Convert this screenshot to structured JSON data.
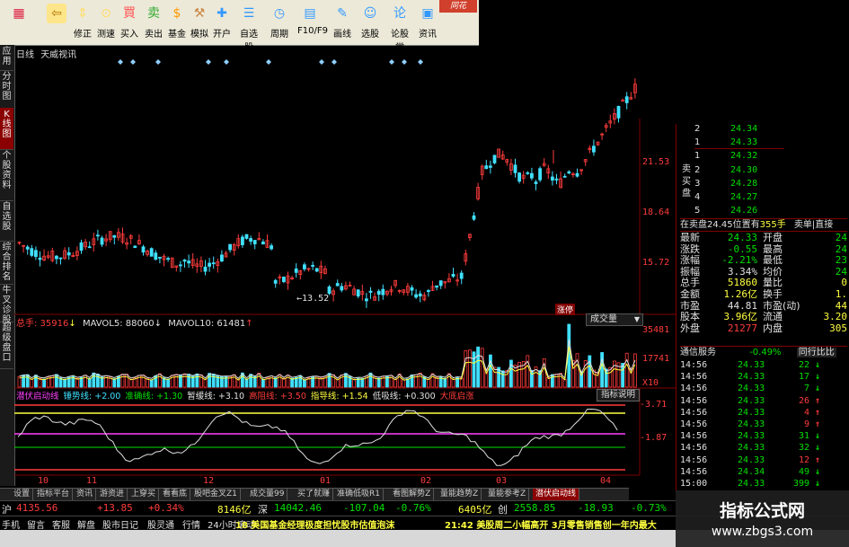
{
  "toolbar": {
    "buttons": [
      {
        "label": "",
        "icon": "grid-icon"
      },
      {
        "label": "",
        "icon": "back-arrow-icon"
      },
      {
        "label": "修正",
        "icon": "up-down-icon"
      },
      {
        "label": "测速",
        "icon": "speed-icon"
      },
      {
        "label": "买入",
        "icon": "buy-icon"
      },
      {
        "label": "卖出",
        "icon": "sell-icon"
      },
      {
        "label": "基金",
        "icon": "fund-icon"
      },
      {
        "label": "模拟",
        "icon": "gavel-icon"
      },
      {
        "label": "开户",
        "icon": "account-icon"
      },
      {
        "label": "自选股",
        "icon": "self-select-icon"
      },
      {
        "label": "周期",
        "icon": "clock-icon"
      },
      {
        "label": "F10/F9",
        "icon": "f10-icon"
      },
      {
        "label": "画线",
        "icon": "pencil-icon"
      },
      {
        "label": "选股",
        "icon": "person-icon"
      },
      {
        "label": "论股堂",
        "icon": "forum-icon"
      },
      {
        "label": "资讯",
        "icon": "news-icon"
      }
    ],
    "brand": "同花"
  },
  "left_tabs": [
    {
      "label": "应用",
      "active": false
    },
    {
      "label": "分时图",
      "active": false
    },
    {
      "label": "K线图",
      "active": true
    },
    {
      "label": "个股资料",
      "active": false
    },
    {
      "label": "自选股",
      "active": false
    },
    {
      "label": "综合排名",
      "active": false
    },
    {
      "label": "牛叉诊股",
      "active": false
    },
    {
      "label": "超级盘口",
      "active": false
    }
  ],
  "chart": {
    "period_label": "日线",
    "source_label": "天威视讯",
    "price_axis": [
      "21.53",
      "18.64",
      "15.72"
    ],
    "low_marker": "13.52",
    "volume_header": {
      "total": "总手: 35916",
      "mavol5": "MAVOL5: 88060",
      "mavol10": "MAVOL10: 61481"
    },
    "volume_axis": [
      "35481",
      "17741",
      "X10"
    ],
    "volume_dropdown": "成交量",
    "tag_label": "涨停",
    "indicator_header": [
      {
        "text": "潜伏启动线",
        "color": "#ff40ff"
      },
      {
        "text": "锤势线: +2.00",
        "color": "#40e0ff"
      },
      {
        "text": "准确线: +1.30",
        "color": "#00e000"
      },
      {
        "text": "暂缓线: +3.10",
        "color": "#e0e0e0"
      },
      {
        "text": "高阻线: +3.50",
        "color": "#ff3c3c"
      },
      {
        "text": "指导线: +1.54",
        "color": "#ffff40"
      },
      {
        "text": "低吸线: +0.300",
        "color": "#e0e0e0"
      },
      {
        "text": "大底启涨",
        "color": "#ff3c3c"
      }
    ],
    "indicator_button": "指标说明",
    "indicator_axis": [
      "3.71",
      "1.87"
    ],
    "x_axis": [
      "10",
      "11",
      "12",
      "01",
      "02",
      "03",
      "04"
    ]
  },
  "right_panel": {
    "sell_label": "卖",
    "buy_label": "买盘",
    "order_book": [
      {
        "level": "2",
        "price": "24.34"
      },
      {
        "level": "1",
        "price": "24.33"
      },
      {
        "level": "1",
        "price": "24.32"
      },
      {
        "level": "2",
        "price": "24.30"
      },
      {
        "level": "3",
        "price": "24.28"
      },
      {
        "level": "4",
        "price": "24.27"
      },
      {
        "level": "5",
        "price": "24.26"
      }
    ],
    "row_in_sell": "在卖盘24.45位置有",
    "row_in_sell_qty": "355手",
    "row_in_sell_action": "卖单",
    "row_in_sell_extra": "直接",
    "stats": [
      {
        "k": "最新",
        "v": "24.33",
        "k2": "开盘",
        "v2": "24"
      },
      {
        "k": "涨跌",
        "v": "-0.55",
        "k2": "最高",
        "v2": "24"
      },
      {
        "k": "涨幅",
        "v": "-2.21%",
        "k2": "最低",
        "v2": "23"
      },
      {
        "k": "振幅",
        "v": "3.34%",
        "k2": "均价",
        "v2": "24"
      },
      {
        "k": "总手",
        "v": "51860",
        "k2": "量比",
        "v2": "0"
      },
      {
        "k": "金额",
        "v": "1.26亿",
        "k2": "换手",
        "v2": "1."
      },
      {
        "k": "市盈",
        "v": "44.81",
        "k2": "市盈(动)",
        "v2": "44"
      },
      {
        "k": "股本",
        "v": "3.96亿",
        "k2": "流通",
        "v2": "3.20"
      },
      {
        "k": "外盘",
        "v": "21277",
        "k2": "内盘",
        "v2": "305"
      }
    ],
    "tick_header": "通信服务",
    "tick_header_pct": "-0.49%",
    "tick_header_btn": "同行比比",
    "ticks": [
      {
        "t": "14:56",
        "p": "24.33",
        "v": "22",
        "dir": "down"
      },
      {
        "t": "14:56",
        "p": "24.33",
        "v": "17",
        "dir": "down"
      },
      {
        "t": "14:56",
        "p": "24.33",
        "v": "7",
        "dir": "down"
      },
      {
        "t": "14:56",
        "p": "24.33",
        "v": "26",
        "dir": "up"
      },
      {
        "t": "14:56",
        "p": "24.33",
        "v": "4",
        "dir": "up"
      },
      {
        "t": "14:56",
        "p": "24.33",
        "v": "9",
        "dir": "up"
      },
      {
        "t": "14:56",
        "p": "24.33",
        "v": "31",
        "dir": "down"
      },
      {
        "t": "14:56",
        "p": "24.33",
        "v": "32",
        "dir": "down"
      },
      {
        "t": "14:56",
        "p": "24.33",
        "v": "12",
        "dir": "up"
      },
      {
        "t": "14:56",
        "p": "24.34",
        "v": "49",
        "dir": "down"
      },
      {
        "t": "15:00",
        "p": "24.33",
        "v": "399",
        "dir": "down"
      }
    ]
  },
  "bottom_tabs": [
    {
      "label": "设置",
      "active": false
    },
    {
      "label": "指标平台",
      "active": false
    },
    {
      "label": "资讯",
      "active": false
    },
    {
      "label": "游资进",
      "active": false
    },
    {
      "label": "上穿买",
      "active": false
    },
    {
      "label": "看看底",
      "active": false
    },
    {
      "label": "股吧金叉Z1",
      "active": false
    },
    {
      "label": "成交量99",
      "active": false
    },
    {
      "label": "买了就赚",
      "active": false
    },
    {
      "label": "准确低吸R1",
      "active": false
    },
    {
      "label": "看图解势Z",
      "active": false
    },
    {
      "label": "量能趋势Z",
      "active": false
    },
    {
      "label": "量能参考Z",
      "active": false
    },
    {
      "label": "潜伏启动线",
      "active": true
    }
  ],
  "status1": {
    "sh_label": "沪",
    "sh_index": "4135.56",
    "sh_change": "+13.85",
    "sh_pct": "+0.34%",
    "sh_amount": "8146亿",
    "sz_label": "深",
    "sz_index": "14042.46",
    "sz_change": "-107.04",
    "sz_pct": "-0.76%",
    "sz_amount": "6405亿",
    "cy_label": "创",
    "cy_index": "2558.85",
    "cy_change": "-18.93",
    "cy_pct": "-0.73%"
  },
  "status2": {
    "items": [
      "手机",
      "留言",
      "客服",
      "解盘",
      "股市日记",
      "股灵通",
      "行情",
      "24小时滚动"
    ],
    "news1": "18 美国基金经理极度担忧股市估值泡沫",
    "news2": "21:42 美股周二小幅高开 3月零售销售创一年内最大"
  },
  "watermark": {
    "title": "指标公式网",
    "url": "www.zbgs3.com"
  }
}
